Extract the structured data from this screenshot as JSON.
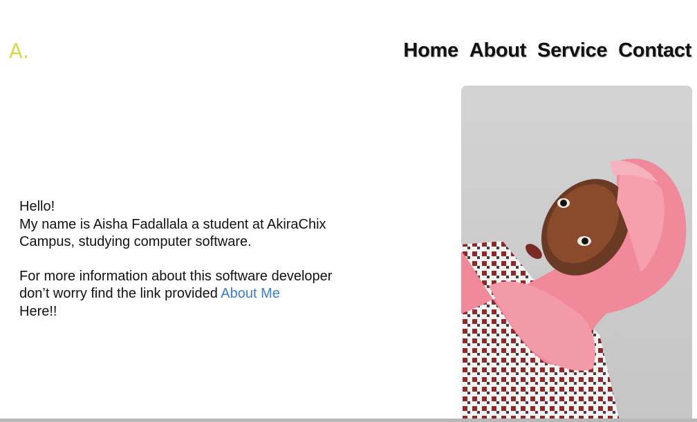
{
  "logo": {
    "text": "A.",
    "color": "#d9d84a"
  },
  "nav": {
    "items": [
      {
        "label": "Home"
      },
      {
        "label": "About"
      },
      {
        "label": "Service"
      },
      {
        "label": "Contact"
      }
    ]
  },
  "intro": {
    "greeting": "Hello!",
    "line1": "My name is Aisha Fadallala a student at AkiraChix",
    "line2": "Campus, studying computer software.",
    "line3": "For more information about this software developer",
    "line4_prefix": "don’t worry find the link provided ",
    "link_label": "About Me",
    "line5": "Here!!"
  },
  "colors": {
    "link": "#3b7fc4",
    "text": "#111111",
    "photo_background": "#cfcfcf",
    "scarf": "#f08a9a"
  },
  "photo": {
    "icon": "profile-photo"
  }
}
